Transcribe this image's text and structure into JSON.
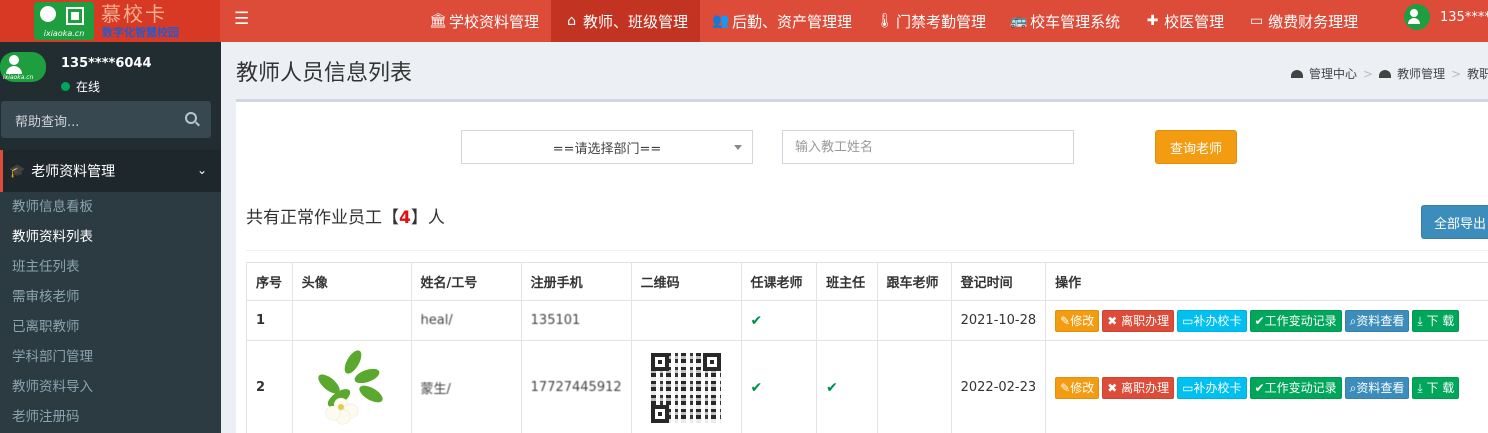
{
  "brand": {
    "title": "慕校卡",
    "subtitle": "数字化智慧校园",
    "domain": "ixiaoka.cn"
  },
  "topnav": {
    "items": [
      {
        "label": "学校资料管理",
        "icon": "bank-icon"
      },
      {
        "label": "教师、班级管理",
        "icon": "home-icon",
        "active": true
      },
      {
        "label": "后勤、资产管理理",
        "icon": "users-icon"
      },
      {
        "label": "门禁考勤管理",
        "icon": "thermometer-icon"
      },
      {
        "label": "校车管理系统",
        "icon": "bus-icon"
      },
      {
        "label": "校医管理",
        "icon": "plus-icon"
      },
      {
        "label": "缴费财务理理",
        "icon": "id-card-icon"
      }
    ],
    "user": "135****6"
  },
  "sidebar": {
    "user_name": "135****6044",
    "status": "在线",
    "search_placeholder": "帮助查询...",
    "section": "老师资料管理",
    "items": [
      {
        "label": "教师信息看板"
      },
      {
        "label": "教师资料列表",
        "current": true
      },
      {
        "label": "班主任列表"
      },
      {
        "label": "需审核老师"
      },
      {
        "label": "已离职教师"
      },
      {
        "label": "学科部门管理"
      },
      {
        "label": "教师资料导入"
      },
      {
        "label": "老师注册码"
      }
    ]
  },
  "page": {
    "title": "教师人员信息列表",
    "breadcrumb": [
      "管理中心",
      "教师管理",
      "教职"
    ]
  },
  "filter": {
    "department_select": "==请选择部门==",
    "name_placeholder": "输入教工姓名",
    "query_button": "查询老师"
  },
  "summary": {
    "prefix": "共有正常作业员工【",
    "count": "4",
    "suffix": "】人",
    "export_button": "全部导出"
  },
  "table": {
    "headers": [
      "序号",
      "头像",
      "姓名/工号",
      "注册手机",
      "二维码",
      "任课老师",
      "班主任",
      "跟车老师",
      "登记时间",
      "操作"
    ],
    "rows": [
      {
        "no": "1",
        "name": "heal/",
        "phone": "135101",
        "teacher": true,
        "head": false,
        "bus": false,
        "date": "2021-10-28"
      },
      {
        "no": "2",
        "name": "蒙生/",
        "phone": "17727445912",
        "teacher": true,
        "head": true,
        "bus": false,
        "date": "2022-02-23"
      }
    ],
    "actions": {
      "edit": "修改",
      "leave": "离职办理",
      "card": "补办校卡",
      "log": "工作变动记录",
      "view": "资料查看",
      "download": "下 载"
    },
    "check_mark": "✔"
  },
  "colors": {
    "topbar": "#dd4b39",
    "sidebar": "#222d32",
    "accent_orange": "#f39c12",
    "accent_blue": "#3c8dbc",
    "success": "#00a65a"
  }
}
